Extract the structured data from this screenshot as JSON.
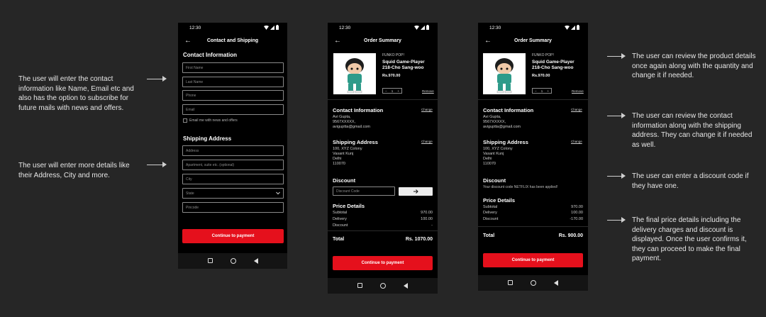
{
  "status_time": "12:30",
  "nav_back": "←",
  "annotations_left": [
    "The user will enter the contact information like Name, Email etc and also has the option to subscribe for future mails with news and offers.",
    "The user will enter more details like their Address, City and more."
  ],
  "annotations_right": [
    "The user can review the product details once again along with the quantity and change it if needed.",
    "The user can review the contact information along with the shipping address. They can change it if needed as well.",
    "The user can enter a discount code if they have one.",
    "The final price details including the delivery charges and discount is displayed. Once the user confirms it, they can proceed to make the final payment."
  ],
  "screen1": {
    "title": "Contact and Shipping",
    "contact_heading": "Contact Information",
    "first_name": "First Name",
    "last_name": "Last Name",
    "phone": "Phone",
    "email": "Email",
    "subscribe_label": "Email me with news and offers",
    "shipping_heading": "Shipping Address",
    "address": "Address",
    "apartment": "Apartment, suite etc. (optional)",
    "city": "City",
    "state": "State",
    "pincode": "Pincode",
    "cta": "Continue to payment"
  },
  "summary": {
    "title": "Order Summary",
    "brand": "FUNKO POP!",
    "product_name_1": "Squid Game-Player",
    "product_name_2": "218-Cho Sang-woo",
    "price": "Rs.970.00",
    "qty": "1",
    "qty_minus": "−",
    "qty_plus": "+",
    "remove": "Remove",
    "contact_heading": "Contact Information",
    "change": "Change",
    "contact_name": "Avi Gupta,",
    "contact_phone": "9567XXXXX,",
    "contact_email": "aviguptta@gmail.com",
    "shipping_heading": "Shipping Address",
    "addr1": "100, XYZ Colony",
    "addr2": "Vasant Kunj",
    "addr3": "Delhi",
    "addr4": "110070",
    "discount_heading": "Discount",
    "discount_placeholder": "Discount Code",
    "discount_applied": "Your discount code NETFLIX has been applied!",
    "price_heading": "Price Details",
    "subtotal_label": "Subtotal",
    "subtotal": "970.00",
    "delivery_label": "Delivery",
    "delivery": "100.00",
    "discount_label": "Discount",
    "discount_before": "-",
    "discount_after": "-170.00",
    "total_label": "Total",
    "total_before": "Rs. 1070.00",
    "total_after": "Rs. 900.00",
    "cta": "Continue to payment"
  },
  "colors": {
    "accent": "#e5101c",
    "background": "#262626",
    "screen": "#000000"
  },
  "icons": [
    "back-arrow-icon",
    "wifi-icon",
    "signal-icon",
    "battery-icon",
    "chevron-down-icon",
    "arrow-right-icon",
    "nav-square-icon",
    "nav-circle-icon",
    "nav-triangle-icon"
  ]
}
